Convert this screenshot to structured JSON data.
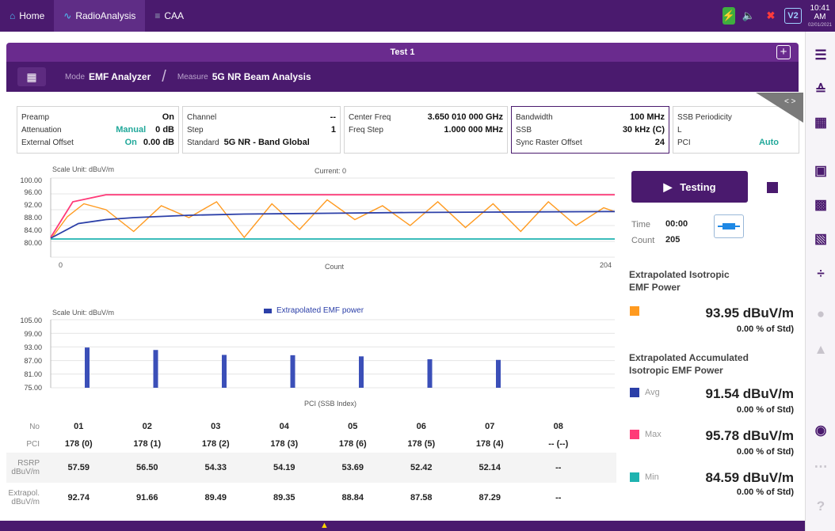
{
  "tabs": [
    {
      "label": "Home",
      "icon": "home-icon"
    },
    {
      "label": "RadioAnalysis",
      "icon": "waveform-icon"
    },
    {
      "label": "CAA",
      "icon": "caa-icon"
    }
  ],
  "status": {
    "time": "10:41 AM",
    "date": "02/01/2021",
    "v2": "V2"
  },
  "title": "Test 1",
  "mode": {
    "label": "Mode",
    "value": "EMF Analyzer"
  },
  "measure": {
    "label": "Measure",
    "value": "5G NR Beam Analysis"
  },
  "params": {
    "preamp": {
      "k": "Preamp",
      "v": "On"
    },
    "attenuation": {
      "k": "Attenuation",
      "mode": "Manual",
      "v": "0 dB"
    },
    "external_offset": {
      "k": "External Offset",
      "mode": "On",
      "v": "0.00 dB"
    },
    "channel": {
      "k": "Channel",
      "v": "--"
    },
    "step": {
      "k": "Step",
      "v": "1"
    },
    "standard": {
      "k": "Standard",
      "v": "5G NR - Band Global"
    },
    "center_freq": {
      "k": "Center Freq",
      "v": "3.650 010 000 GHz"
    },
    "freq_step": {
      "k": "Freq Step",
      "v": "1.000 000 MHz"
    },
    "bandwidth": {
      "k": "Bandwidth",
      "v": "100 MHz"
    },
    "ssb": {
      "k": "SSB",
      "v": "30 kHz (C)"
    },
    "sync_raster": {
      "k": "Sync Raster Offset",
      "v": "24"
    },
    "ssb_periodicity": {
      "k": "SSB Periodicity",
      "v": ""
    },
    "l": {
      "k": "L",
      "v": ""
    },
    "pci": {
      "k": "PCI",
      "v": "Auto"
    }
  },
  "chart_top": {
    "scale_unit": "Scale Unit: dBuV/m",
    "current": "Current: 0",
    "yticks": [
      "100.00",
      "96.00",
      "92.00",
      "88.00",
      "84.00",
      "80.00"
    ],
    "x_start": "0",
    "x_end": "204",
    "xlabel": "Count"
  },
  "chart_bottom": {
    "scale_unit": "Scale Unit: dBuV/m",
    "legend": "Extrapolated EMF power",
    "yticks": [
      "105.00",
      "99.00",
      "93.00",
      "87.00",
      "81.00",
      "75.00"
    ],
    "xlabel": "PCI (SSB Index)"
  },
  "chart_data": [
    {
      "type": "line",
      "xlabel": "Count",
      "ylabel": "",
      "xlim": [
        0,
        204
      ],
      "ylim": [
        80,
        100
      ],
      "series": [
        {
          "values_note": "",
          "color": "#ff9a1f",
          "x": [
            0,
            6,
            12,
            20,
            30,
            40,
            50,
            60,
            70,
            80,
            90,
            100,
            110,
            120,
            130,
            140,
            150,
            160,
            170,
            180,
            190,
            200,
            204
          ],
          "y": [
            84.5,
            90.2,
            93.5,
            92.0,
            86.5,
            93.0,
            90.0,
            94.0,
            85.0,
            93.5,
            87.0,
            94.5,
            89.5,
            93.0,
            88.0,
            94.0,
            87.5,
            93.5,
            86.5,
            94.0,
            88.0,
            92.5,
            91.5
          ]
        },
        {
          "color": "#ff3a78",
          "x": [
            0,
            8,
            20,
            40,
            100,
            204
          ],
          "y": [
            85.0,
            94.0,
            95.78,
            95.78,
            95.78,
            95.78
          ]
        },
        {
          "color": "#2b3fa8",
          "x": [
            0,
            10,
            20,
            30,
            50,
            70,
            100,
            130,
            160,
            204
          ],
          "y": [
            84.8,
            88.5,
            89.5,
            90.0,
            90.6,
            90.9,
            91.1,
            91.3,
            91.4,
            91.54
          ]
        },
        {
          "color": "#1fb3b0",
          "x": [
            0,
            204
          ],
          "y": [
            84.59,
            84.59
          ]
        }
      ]
    },
    {
      "type": "bar",
      "categories": [
        "178 (0)",
        "178 (1)",
        "178 (2)",
        "178 (3)",
        "178 (6)",
        "178 (5)",
        "178 (4)"
      ],
      "series": [
        {
          "name": "Extrapolated EMF power",
          "values": [
            92.74,
            91.66,
            89.49,
            89.35,
            88.84,
            87.58,
            87.29
          ]
        }
      ],
      "xlabel": "PCI (SSB Index)",
      "ylim": [
        75,
        105
      ]
    }
  ],
  "right": {
    "testing": "Testing",
    "time_k": "Time",
    "time_v": "00:00",
    "count_k": "Count",
    "count_v": "205",
    "iso_title": "Extrapolated Isotropic EMF Power",
    "iso_value": "93.95 dBuV/m",
    "iso_pct": "0.00 % of Std)",
    "acc_title": "Extrapolated Accumulated Isotropic EMF Power",
    "avg_k": "Avg",
    "avg_v": "91.54 dBuV/m",
    "avg_pct": "0.00 % of Std)",
    "max_k": "Max",
    "max_v": "95.78 dBuV/m",
    "max_pct": "0.00 % of Std)",
    "min_k": "Min",
    "min_v": "84.59 dBuV/m",
    "min_pct": "0.00 % of Std)",
    "colors": {
      "iso": "#ff9a1f",
      "avg": "#2b3fa8",
      "max": "#ff3a78",
      "min": "#1fb3b0"
    }
  },
  "table": {
    "headers": {
      "no": "No",
      "pci": "PCI",
      "rsrp": "RSRP dBuV/m",
      "extrap": "Extrapol. dBuV/m"
    },
    "no": [
      "01",
      "02",
      "03",
      "04",
      "05",
      "06",
      "07",
      "08"
    ],
    "pci": [
      "178 (0)",
      "178 (1)",
      "178 (2)",
      "178 (3)",
      "178 (6)",
      "178 (5)",
      "178 (4)",
      "-- (--)"
    ],
    "rsrp": [
      "57.59",
      "56.50",
      "54.33",
      "54.19",
      "53.69",
      "52.42",
      "52.14",
      "--"
    ],
    "extrap": [
      "92.74",
      "91.66",
      "89.49",
      "89.35",
      "88.84",
      "87.58",
      "87.29",
      "--"
    ]
  }
}
